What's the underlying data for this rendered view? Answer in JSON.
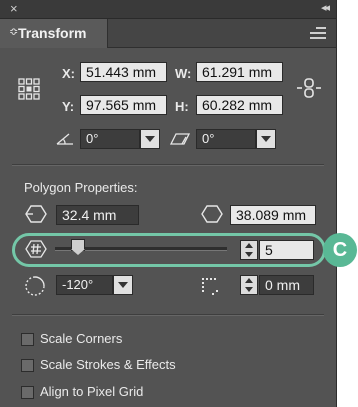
{
  "panel": {
    "close_glyph": "×",
    "collapse_glyph": "◂◂",
    "tab_arrows": "≎",
    "tab_title": "Transform"
  },
  "transform": {
    "x_label": "X:",
    "x_value": "51.443 mm",
    "y_label": "Y:",
    "y_value": "97.565 mm",
    "w_label": "W:",
    "w_value": "61.291 mm",
    "h_label": "H:",
    "h_value": "60.282 mm",
    "rotate_value": "0°",
    "shear_value": "0°"
  },
  "polygon": {
    "heading": "Polygon Properties:",
    "side_length": "32.4 mm",
    "radius": "38.089 mm",
    "side_count": "5",
    "side_count_level": 0.13,
    "angle": "-120°",
    "corner_radius": "0 mm"
  },
  "options": [
    {
      "label": "Scale Corners",
      "checked": false
    },
    {
      "label": "Scale Strokes & Effects",
      "checked": false
    },
    {
      "label": "Align to Pixel Grid",
      "checked": false
    }
  ],
  "callout_label": "C",
  "colors": {
    "panel_bg": "#535353",
    "highlight": "#74c7a8",
    "callout_bg": "#59b895"
  }
}
